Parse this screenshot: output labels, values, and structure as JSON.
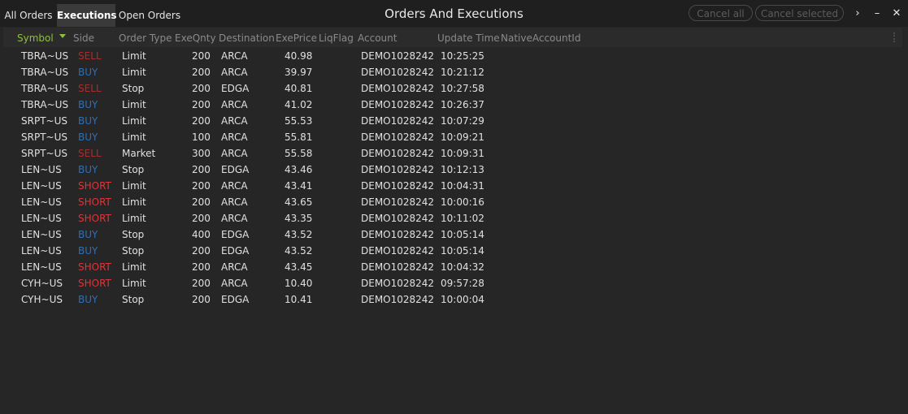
{
  "tabs": [
    {
      "label": "All Orders",
      "active": false
    },
    {
      "label": "Executions",
      "active": true
    },
    {
      "label": "Open Orders",
      "active": false
    }
  ],
  "window_title": "Orders And Executions",
  "buttons": {
    "cancel_all": "Cancel all",
    "cancel_selected": "Cancel selected",
    "expand": "›",
    "minimize": "–",
    "close": "✕"
  },
  "columns": {
    "symbol": "Symbol",
    "side": "Side",
    "order_type": "Order Type",
    "exe_qnty": "ExeQnty",
    "destination": "Destination",
    "exe_price": "ExePrice",
    "liq_flag": "LiqFlag",
    "account": "Account",
    "update_time": "Update Time",
    "native_account_id": "NativeAccountId"
  },
  "sorted_column": "symbol",
  "colors": {
    "sell": "#b02a2a",
    "buy": "#2f6fb5",
    "short": "#d8383b",
    "sort_accent": "#8fbf3f"
  },
  "rows": [
    {
      "symbol": "TBRA~US",
      "side": "SELL",
      "order_type": "Limit",
      "exe_qnty": "200",
      "destination": "ARCA",
      "exe_price": "40.98",
      "account": "DEMO1028242",
      "update_time": "10:25:25"
    },
    {
      "symbol": "TBRA~US",
      "side": "BUY",
      "order_type": "Limit",
      "exe_qnty": "200",
      "destination": "ARCA",
      "exe_price": "39.97",
      "account": "DEMO1028242",
      "update_time": "10:21:12"
    },
    {
      "symbol": "TBRA~US",
      "side": "SELL",
      "order_type": "Stop",
      "exe_qnty": "200",
      "destination": "EDGA",
      "exe_price": "40.81",
      "account": "DEMO1028242",
      "update_time": "10:27:58"
    },
    {
      "symbol": "TBRA~US",
      "side": "BUY",
      "order_type": "Limit",
      "exe_qnty": "200",
      "destination": "ARCA",
      "exe_price": "41.02",
      "account": "DEMO1028242",
      "update_time": "10:26:37"
    },
    {
      "symbol": "SRPT~US",
      "side": "BUY",
      "order_type": "Limit",
      "exe_qnty": "200",
      "destination": "ARCA",
      "exe_price": "55.53",
      "account": "DEMO1028242",
      "update_time": "10:07:29"
    },
    {
      "symbol": "SRPT~US",
      "side": "BUY",
      "order_type": "Limit",
      "exe_qnty": "100",
      "destination": "ARCA",
      "exe_price": "55.81",
      "account": "DEMO1028242",
      "update_time": "10:09:21"
    },
    {
      "symbol": "SRPT~US",
      "side": "SELL",
      "order_type": "Market",
      "exe_qnty": "300",
      "destination": "ARCA",
      "exe_price": "55.58",
      "account": "DEMO1028242",
      "update_time": "10:09:31"
    },
    {
      "symbol": "LEN~US",
      "side": "BUY",
      "order_type": "Stop",
      "exe_qnty": "200",
      "destination": "EDGA",
      "exe_price": "43.46",
      "account": "DEMO1028242",
      "update_time": "10:12:13"
    },
    {
      "symbol": "LEN~US",
      "side": "SHORT",
      "order_type": "Limit",
      "exe_qnty": "200",
      "destination": "ARCA",
      "exe_price": "43.41",
      "account": "DEMO1028242",
      "update_time": "10:04:31"
    },
    {
      "symbol": "LEN~US",
      "side": "SHORT",
      "order_type": "Limit",
      "exe_qnty": "200",
      "destination": "ARCA",
      "exe_price": "43.65",
      "account": "DEMO1028242",
      "update_time": "10:00:16"
    },
    {
      "symbol": "LEN~US",
      "side": "SHORT",
      "order_type": "Limit",
      "exe_qnty": "200",
      "destination": "ARCA",
      "exe_price": "43.35",
      "account": "DEMO1028242",
      "update_time": "10:11:02"
    },
    {
      "symbol": "LEN~US",
      "side": "BUY",
      "order_type": "Stop",
      "exe_qnty": "400",
      "destination": "EDGA",
      "exe_price": "43.52",
      "account": "DEMO1028242",
      "update_time": "10:05:14"
    },
    {
      "symbol": "LEN~US",
      "side": "BUY",
      "order_type": "Stop",
      "exe_qnty": "200",
      "destination": "EDGA",
      "exe_price": "43.52",
      "account": "DEMO1028242",
      "update_time": "10:05:14"
    },
    {
      "symbol": "LEN~US",
      "side": "SHORT",
      "order_type": "Limit",
      "exe_qnty": "200",
      "destination": "ARCA",
      "exe_price": "43.45",
      "account": "DEMO1028242",
      "update_time": "10:04:32"
    },
    {
      "symbol": "CYH~US",
      "side": "SHORT",
      "order_type": "Limit",
      "exe_qnty": "200",
      "destination": "ARCA",
      "exe_price": "10.40",
      "account": "DEMO1028242",
      "update_time": "09:57:28"
    },
    {
      "symbol": "CYH~US",
      "side": "BUY",
      "order_type": "Stop",
      "exe_qnty": "200",
      "destination": "EDGA",
      "exe_price": "10.41",
      "account": "DEMO1028242",
      "update_time": "10:00:04"
    }
  ]
}
